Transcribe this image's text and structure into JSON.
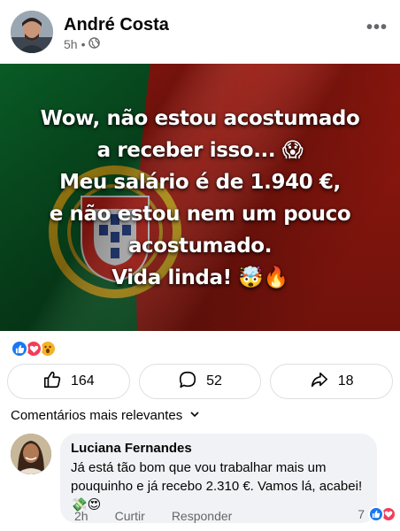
{
  "post": {
    "author": "André Costa",
    "time": "5h",
    "separator": "•",
    "more_label": "•••",
    "image_text_lines": [
      "Wow, não estou acostumado",
      "a receber isso... 😱",
      "Meu salário é de 1.940 €,",
      "e não estou nem um pouco",
      "acostumado.",
      "Vida linda! 🤯🔥"
    ],
    "reaction_icons": [
      "like-icon",
      "love-icon",
      "wow-icon"
    ],
    "colors": {
      "flag_green": "#046a38",
      "flag_red": "#da291c",
      "like_blue": "#1877f2",
      "love_red": "#f33e58",
      "wow_yellow": "#f7b125"
    }
  },
  "actions": {
    "like_count": "164",
    "comment_count": "52",
    "share_count": "18"
  },
  "comments_section": {
    "label": "Comentários mais relevantes"
  },
  "comment": {
    "author": "Luciana Fernandes",
    "text": "Já está tão bom que vou trabalhar mais um pouquinho e já recebo 2.310 €. Vamos lá, acabei! 💸😍",
    "time": "2h",
    "like_label": "Curtir",
    "reply_label": "Responder",
    "reaction_count": "7"
  }
}
